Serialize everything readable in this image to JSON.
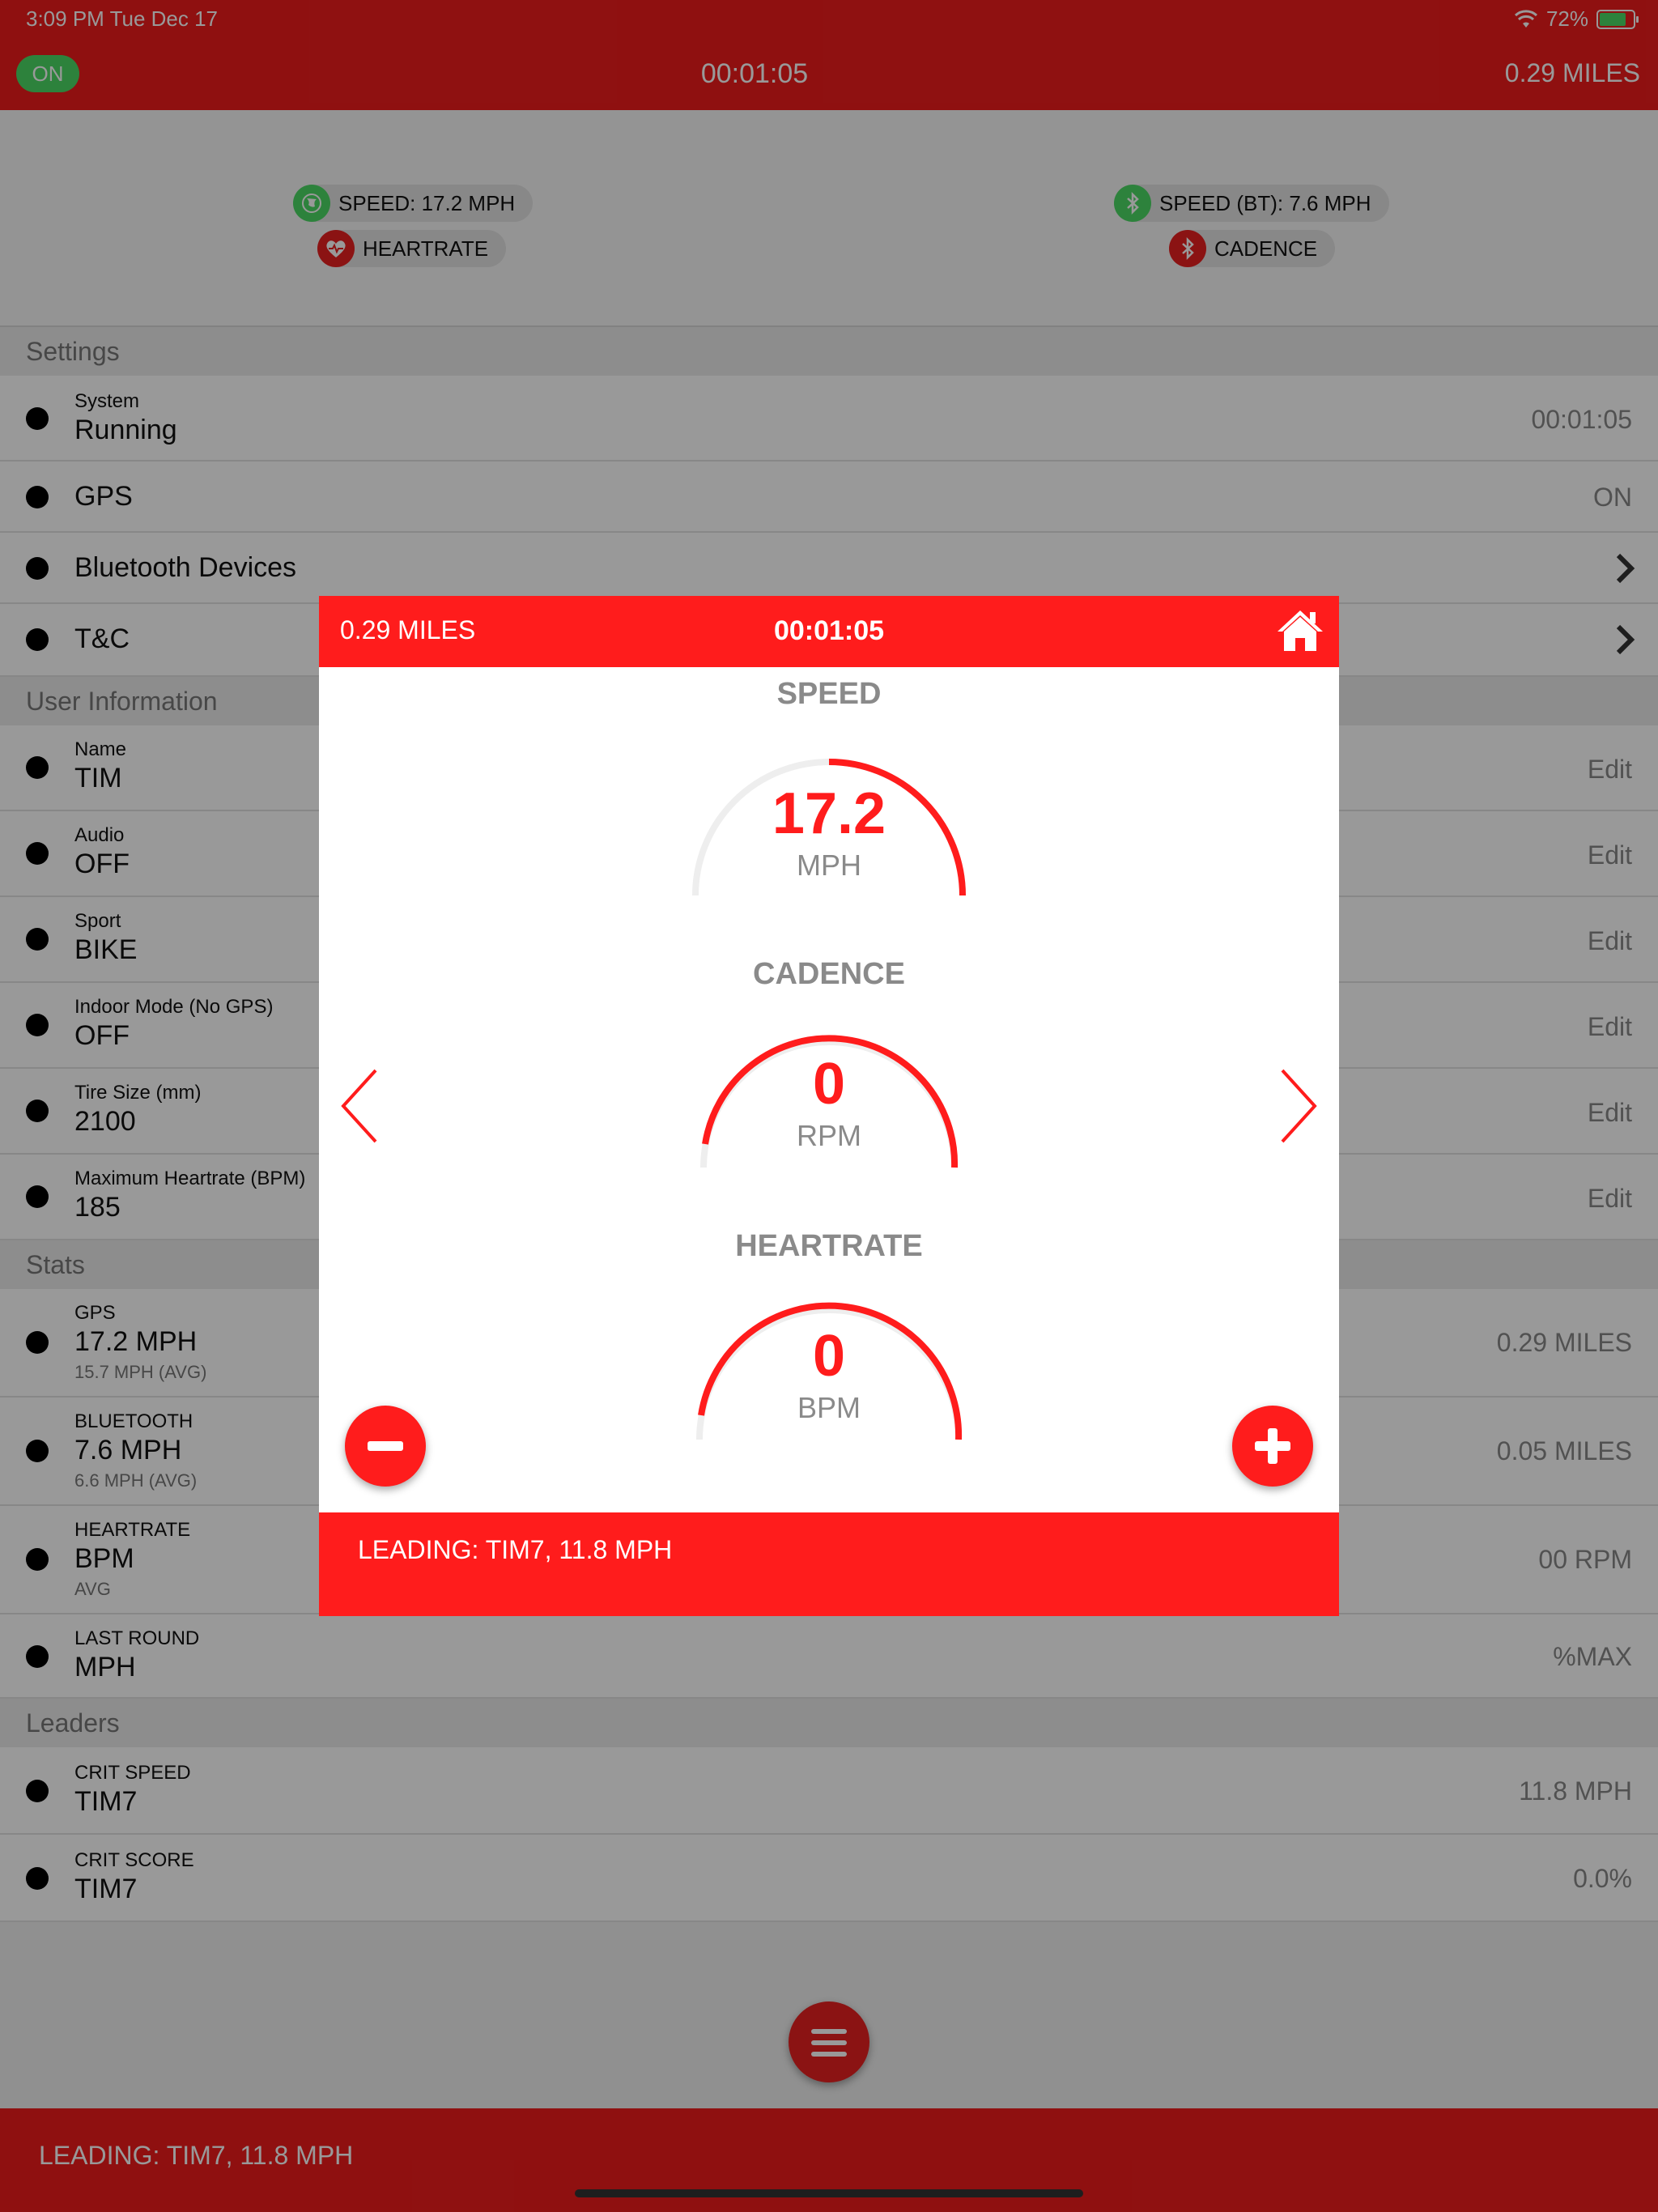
{
  "status_bar": {
    "time": "3:09 PM   Tue Dec 17",
    "battery": "72%"
  },
  "top_bar": {
    "toggle_label": "ON",
    "timer": "00:01:05",
    "distance": "0.29 MILES"
  },
  "sensors": {
    "speed_gps": "SPEED: 17.2 MPH",
    "heartrate": "HEARTRATE",
    "speed_bt": "SPEED (BT): 7.6 MPH",
    "cadence": "CADENCE"
  },
  "sections": {
    "settings": "Settings",
    "user_info": "User Information",
    "stats": "Stats",
    "leaders": "Leaders"
  },
  "settings": {
    "system_label": "System",
    "system_value": "Running",
    "system_right": "00:01:05",
    "gps_label": "GPS",
    "gps_right": "ON",
    "bluetooth_label": "Bluetooth Devices",
    "tc_label": "T&C"
  },
  "user_info": {
    "edit_label": "Edit",
    "name_label": "Name",
    "name_value": "TIM",
    "audio_label": "Audio",
    "audio_value": "OFF",
    "sport_label": "Sport",
    "sport_value": "BIKE",
    "indoor_label": "Indoor Mode (No GPS)",
    "indoor_value": "OFF",
    "tire_label": "Tire Size (mm)",
    "tire_value": "2100",
    "maxhr_label": "Maximum Heartrate (BPM)",
    "maxhr_value": "185"
  },
  "stats": {
    "gps_label": "GPS",
    "gps_value": "17.2 MPH",
    "gps_sub": "15.7 MPH (AVG)",
    "gps_right": "0.29 MILES",
    "bt_label": "BLUETOOTH",
    "bt_value": "7.6 MPH",
    "bt_sub": "6.6 MPH (AVG)",
    "bt_right": "0.05 MILES",
    "hr_label": "HEARTRATE",
    "hr_value": "BPM",
    "hr_sub": "AVG",
    "hr_right": "00 RPM",
    "round_label": "LAST ROUND",
    "round_value": "MPH",
    "round_right": "%MAX"
  },
  "leaders": {
    "crit_speed_label": "CRIT SPEED",
    "crit_speed_value": "TIM7",
    "crit_speed_right": "11.8 MPH",
    "crit_score_label": "CRIT SCORE",
    "crit_score_value": "TIM7",
    "crit_score_right": "0.0%"
  },
  "bottom_bar": {
    "leading": "LEADING: TIM7, 11.8 MPH"
  },
  "modal": {
    "distance": "0.29 MILES",
    "timer": "00:01:05",
    "leading": "LEADING: TIM7, 11.8 MPH",
    "gauges": [
      {
        "label": "SPEED",
        "value": "17.2",
        "unit": "MPH",
        "fill_fraction": 0.5
      },
      {
        "label": "CADENCE",
        "value": "0",
        "unit": "RPM",
        "fill_fraction": 0.92
      },
      {
        "label": "HEARTRATE",
        "value": "0",
        "unit": "BPM",
        "fill_fraction": 0.92
      }
    ]
  },
  "colors": {
    "accent": "#ff1c1c",
    "on_green": "#4cd964",
    "gauge_track": "#eeeeee"
  },
  "icons": [
    "wifi-icon",
    "battery-icon",
    "globe-icon",
    "heart-icon",
    "bluetooth-icon",
    "chevron-right-icon",
    "home-icon",
    "chevron-left-icon",
    "minus-icon",
    "plus-icon",
    "hamburger-menu-icon"
  ]
}
